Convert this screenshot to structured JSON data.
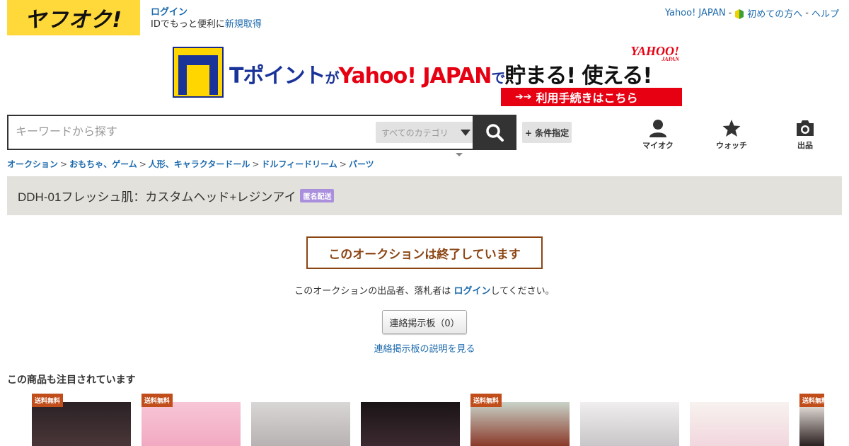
{
  "header": {
    "logo_text": "ヤフオク!",
    "login_label": "ログイン",
    "login_sub_prefix": "IDでもっと便利に",
    "register_label": "新規取得",
    "top_links": [
      "Yahoo! JAPAN",
      "初めての方へ",
      "ヘルプ"
    ],
    "separator": "-"
  },
  "banner": {
    "text_tpoint": "Tポイント",
    "text_ga": "が",
    "text_yahoo": "Yahoo! JAPAN",
    "text_de": "で",
    "text_tamaru": "貯まる! 使える!",
    "yahoo_logo": "YAHOO!",
    "yahoo_logo_sub": "JAPAN",
    "cta_arrows": "➔➔",
    "cta_label": "利用手続きはこちら"
  },
  "search": {
    "placeholder": "キーワードから探す",
    "category_label": "すべてのカテゴリ",
    "condition_label": "+ 条件指定"
  },
  "nav": {
    "myauc_label": "マイオク",
    "watch_label": "ウォッチ",
    "sell_label": "出品"
  },
  "breadcrumb": [
    "オークション",
    "おもちゃ、ゲーム",
    "人形、キャラクタードール",
    "ドルフィードリーム",
    "パーツ"
  ],
  "breadcrumb_sep": ">",
  "item": {
    "title": "DDH-01フレッシュ肌：カスタムヘッド+レジンアイ",
    "badge": "匿名配送"
  },
  "ended": {
    "notice": "このオークションは終了しています",
    "msg_prefix": "このオークションの出品者、落札者は ",
    "msg_link": "ログイン",
    "msg_suffix": "してください。",
    "board_button": "連絡掲示板（0）",
    "board_help": "連絡掲示板の説明を見る"
  },
  "related": {
    "title": "この商品も注目されています",
    "items": [
      {
        "badge": "送料無料",
        "color_top": "#2a2225",
        "color_bottom": "#4a3638"
      },
      {
        "badge": "送料無料",
        "color_top": "#f7c6d6",
        "color_bottom": "#f2a9c2"
      },
      {
        "badge": "",
        "color_top": "#d9d6d6",
        "color_bottom": "#b8b2b2"
      },
      {
        "badge": "",
        "color_top": "#1a1416",
        "color_bottom": "#3c2a30"
      },
      {
        "badge": "送料無料",
        "color_top": "#c9d2c8",
        "color_bottom": "#8a3a2a"
      },
      {
        "badge": "",
        "color_top": "#f0eeee",
        "color_bottom": "#c9c6c9"
      },
      {
        "badge": "",
        "color_top": "#f7f2ef",
        "color_bottom": "#f2d7de"
      },
      {
        "badge": "送料無料",
        "color_top": "#f2ece6",
        "color_bottom": "#2a2020"
      }
    ]
  }
}
